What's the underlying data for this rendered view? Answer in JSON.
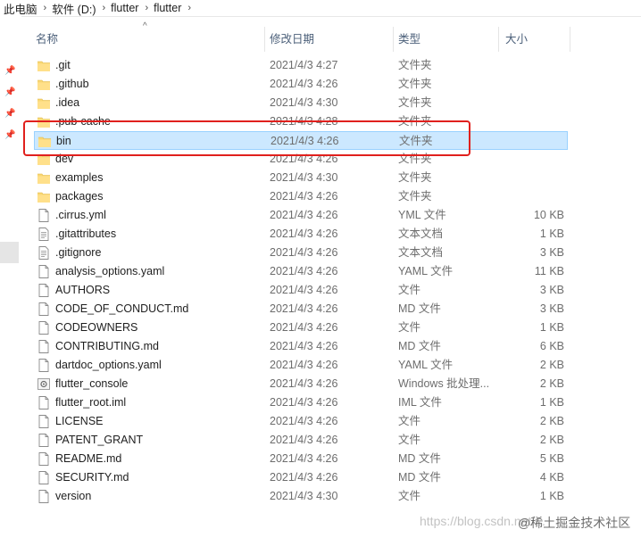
{
  "breadcrumb": [
    "此电脑",
    "软件 (D:)",
    "flutter",
    "flutter"
  ],
  "columns": {
    "name": "名称",
    "date": "修改日期",
    "type": "类型",
    "size": "大小"
  },
  "files": [
    {
      "name": ".git",
      "date": "2021/4/3 4:27",
      "type": "文件夹",
      "size": "",
      "icon": "folder-icon"
    },
    {
      "name": ".github",
      "date": "2021/4/3 4:26",
      "type": "文件夹",
      "size": "",
      "icon": "folder-icon"
    },
    {
      "name": ".idea",
      "date": "2021/4/3 4:30",
      "type": "文件夹",
      "size": "",
      "icon": "folder-icon"
    },
    {
      "name": ".pub-cache",
      "date": "2021/4/3 4:28",
      "type": "文件夹",
      "size": "",
      "icon": "folder-icon"
    },
    {
      "name": "bin",
      "date": "2021/4/3 4:26",
      "type": "文件夹",
      "size": "",
      "icon": "folder-icon",
      "selected": true
    },
    {
      "name": "dev",
      "date": "2021/4/3 4:26",
      "type": "文件夹",
      "size": "",
      "icon": "folder-icon"
    },
    {
      "name": "examples",
      "date": "2021/4/3 4:30",
      "type": "文件夹",
      "size": "",
      "icon": "folder-icon"
    },
    {
      "name": "packages",
      "date": "2021/4/3 4:26",
      "type": "文件夹",
      "size": "",
      "icon": "folder-icon"
    },
    {
      "name": ".cirrus.yml",
      "date": "2021/4/3 4:26",
      "type": "YML 文件",
      "size": "10 KB",
      "icon": "file-icon"
    },
    {
      "name": ".gitattributes",
      "date": "2021/4/3 4:26",
      "type": "文本文档",
      "size": "1 KB",
      "icon": "text-file-icon"
    },
    {
      "name": ".gitignore",
      "date": "2021/4/3 4:26",
      "type": "文本文档",
      "size": "3 KB",
      "icon": "text-file-icon"
    },
    {
      "name": "analysis_options.yaml",
      "date": "2021/4/3 4:26",
      "type": "YAML 文件",
      "size": "11 KB",
      "icon": "file-icon"
    },
    {
      "name": "AUTHORS",
      "date": "2021/4/3 4:26",
      "type": "文件",
      "size": "3 KB",
      "icon": "file-icon"
    },
    {
      "name": "CODE_OF_CONDUCT.md",
      "date": "2021/4/3 4:26",
      "type": "MD 文件",
      "size": "3 KB",
      "icon": "file-icon"
    },
    {
      "name": "CODEOWNERS",
      "date": "2021/4/3 4:26",
      "type": "文件",
      "size": "1 KB",
      "icon": "file-icon"
    },
    {
      "name": "CONTRIBUTING.md",
      "date": "2021/4/3 4:26",
      "type": "MD 文件",
      "size": "6 KB",
      "icon": "file-icon"
    },
    {
      "name": "dartdoc_options.yaml",
      "date": "2021/4/3 4:26",
      "type": "YAML 文件",
      "size": "2 KB",
      "icon": "file-icon"
    },
    {
      "name": "flutter_console",
      "date": "2021/4/3 4:26",
      "type": "Windows 批处理...",
      "size": "2 KB",
      "icon": "batch-file-icon"
    },
    {
      "name": "flutter_root.iml",
      "date": "2021/4/3 4:26",
      "type": "IML 文件",
      "size": "1 KB",
      "icon": "file-icon"
    },
    {
      "name": "LICENSE",
      "date": "2021/4/3 4:26",
      "type": "文件",
      "size": "2 KB",
      "icon": "file-icon"
    },
    {
      "name": "PATENT_GRANT",
      "date": "2021/4/3 4:26",
      "type": "文件",
      "size": "2 KB",
      "icon": "file-icon"
    },
    {
      "name": "README.md",
      "date": "2021/4/3 4:26",
      "type": "MD 文件",
      "size": "5 KB",
      "icon": "file-icon"
    },
    {
      "name": "SECURITY.md",
      "date": "2021/4/3 4:26",
      "type": "MD 文件",
      "size": "4 KB",
      "icon": "file-icon"
    },
    {
      "name": "version",
      "date": "2021/4/3 4:30",
      "type": "文件",
      "size": "1 KB",
      "icon": "file-icon"
    }
  ],
  "watermark": {
    "url": "https://blog.csdn.net/...",
    "brand": "@稀土掘金技术社区"
  },
  "colors": {
    "selection": "#cce8ff",
    "highlight": "#e0201d",
    "folder": "#f8d775"
  }
}
